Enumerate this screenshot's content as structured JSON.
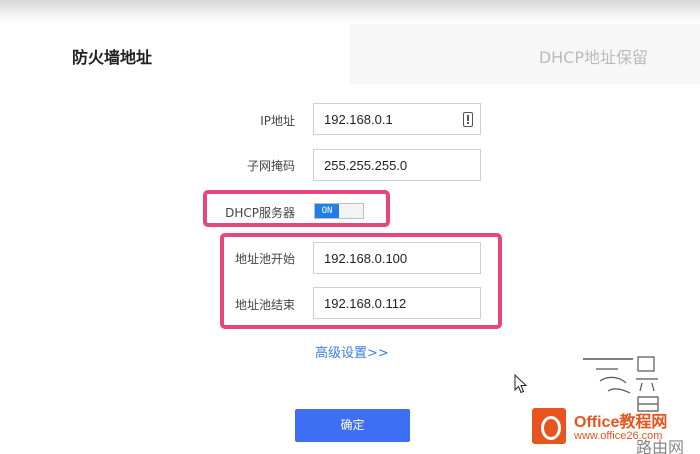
{
  "tabs": {
    "firewall_address": "防火墙地址",
    "dhcp_reservation": "DHCP地址保留"
  },
  "form": {
    "ip_label": "IP地址",
    "ip_value": "192.168.0.1",
    "mask_label": "子网掩码",
    "mask_value": "255.255.255.0",
    "dhcp_label": "DHCP服务器",
    "dhcp_toggle_text": "ON",
    "pool_start_label": "地址池开始",
    "pool_start_value": "192.168.0.100",
    "pool_end_label": "地址池结束",
    "pool_end_value": "192.168.0.112",
    "advanced_link": "高级设置>>",
    "confirm_button": "确定"
  },
  "watermark": {
    "badge_title": "Office教程网",
    "badge_url": "www.office26.com",
    "side_text": "路由网"
  },
  "colors": {
    "highlight": "#e8457a",
    "accent": "#3d6ef3",
    "toggle_on": "#1f7ee8",
    "link": "#3a7fe0",
    "watermark_orange": "#e8541e"
  },
  "icons": [
    "warning-icon",
    "mouse-cursor-icon",
    "office-logo-icon"
  ]
}
